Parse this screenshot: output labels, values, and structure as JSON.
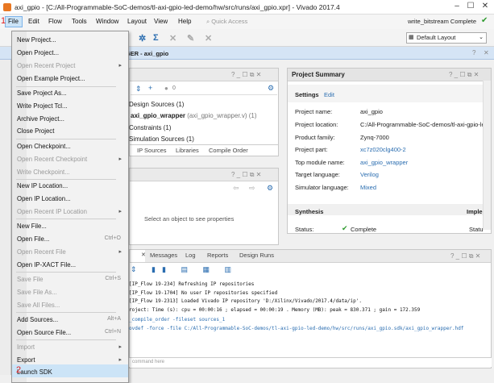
{
  "window": {
    "title": "axi_gpio - [C:/All-Programmable-SoC-demos/tl-axi-gpio-led-demo/hw/src/runs/axi_gpio.xpr] - Vivado 2017.4"
  },
  "menubar": {
    "items": [
      "File",
      "Edit",
      "Flow",
      "Tools",
      "Window",
      "Layout",
      "View",
      "Help"
    ],
    "quick_access": "Quick Access",
    "status": "write_bitstream Complete"
  },
  "toolbar": {
    "layout": "Default Layout"
  },
  "flow_header": {
    "title": "NAGER - axi_gpio"
  },
  "sources": {
    "rows": [
      "Design Sources (1)",
      "axi_gpio_wrapper",
      "(axi_gpio_wrapper.v) (1)",
      "Constraints (1)",
      "Simulation Sources (1)"
    ],
    "tabs": [
      "IP Sources",
      "Libraries",
      "Compile Order"
    ],
    "count": "0"
  },
  "properties": {
    "empty": "Select an object to see properties"
  },
  "summary": {
    "title": "Project Summary",
    "tabs": [
      "Settings",
      "Edit"
    ],
    "rows": [
      [
        "Project name:",
        "axi_gpio"
      ],
      [
        "Project location:",
        "C:/All-Programmable-SoC-demos/tl-axi-gpio-le"
      ],
      [
        "Product family:",
        "Zynq-7000"
      ],
      [
        "Project part:",
        "xc7z020clg400-2"
      ],
      [
        "Top module name:",
        "axi_gpio_wrapper"
      ],
      [
        "Target language:",
        "Verilog"
      ],
      [
        "Simulator language:",
        "Mixed"
      ]
    ],
    "synthesis": "Synthesis",
    "implementation": "Imple",
    "status_label": "Status:",
    "status_value": "Complete",
    "status_right": "Statu"
  },
  "console": {
    "tabs": [
      "Messages",
      "Log",
      "Reports",
      "Design Runs"
    ],
    "lines": [
      "[IP_Flow 19-234] Refreshing IP repositories",
      "[IP_Flow 19-1704] No user IP repositories specified",
      "[IP_Flow 19-2313] Loaded Vivado IP repository 'D:/Xilinx/Vivado/2017.4/data/ip'.",
      "roject: Time (s): cpu = 00:00:16 ; elapsed = 00:00:19 . Memory (MB): peak = 830.371 ; gain = 172.359",
      "_compile_order -fileset sources_1",
      "ovdef -force  -file C:/All-Programmable-SoC-demos/tl-axi-gpio-led-demo/hw/src/runs/axi_gpio.sdk/axi_gpio_wrapper.hdf"
    ],
    "prompt": "command here"
  },
  "file_menu": {
    "items": [
      {
        "label": "New Project...",
        "disabled": false
      },
      {
        "label": "Open Project...",
        "disabled": false
      },
      {
        "label": "Open Recent Project",
        "disabled": true,
        "submenu": true
      },
      {
        "label": "Open Example Project...",
        "disabled": false
      },
      {
        "label": "Save Project As...",
        "disabled": false
      },
      {
        "label": "Write Project Tcl...",
        "disabled": false
      },
      {
        "label": "Archive Project...",
        "disabled": false
      },
      {
        "label": "Close Project",
        "disabled": false
      },
      {
        "label": "Open Checkpoint...",
        "disabled": false
      },
      {
        "label": "Open Recent Checkpoint",
        "disabled": true,
        "submenu": true
      },
      {
        "label": "Write Checkpoint...",
        "disabled": true
      },
      {
        "label": "New IP Location...",
        "disabled": false
      },
      {
        "label": "Open IP Location...",
        "disabled": false
      },
      {
        "label": "Open Recent IP Location",
        "disabled": true,
        "submenu": true
      },
      {
        "label": "New File...",
        "disabled": false
      },
      {
        "label": "Open File...",
        "disabled": false,
        "shortcut": "Ctrl+O"
      },
      {
        "label": "Open Recent File",
        "disabled": true,
        "submenu": true
      },
      {
        "label": "Open IP-XACT File...",
        "disabled": false
      },
      {
        "label": "Save File",
        "disabled": true,
        "shortcut": "Ctrl+S"
      },
      {
        "label": "Save File As...",
        "disabled": true
      },
      {
        "label": "Save All Files...",
        "disabled": true
      },
      {
        "label": "Add Sources...",
        "disabled": false,
        "shortcut": "Alt+A"
      },
      {
        "label": "Open Source File...",
        "disabled": false,
        "shortcut": "Ctrl+N"
      },
      {
        "label": "Import",
        "disabled": true,
        "submenu": true
      },
      {
        "label": "Export",
        "disabled": false,
        "submenu": true
      },
      {
        "label": "Launch SDK",
        "disabled": false
      }
    ]
  },
  "annotations": {
    "one": "1",
    "two": "2"
  },
  "colors": {
    "accent": "#2a6db0",
    "highlight": "#cce4f7",
    "annotation": "#e02020"
  }
}
